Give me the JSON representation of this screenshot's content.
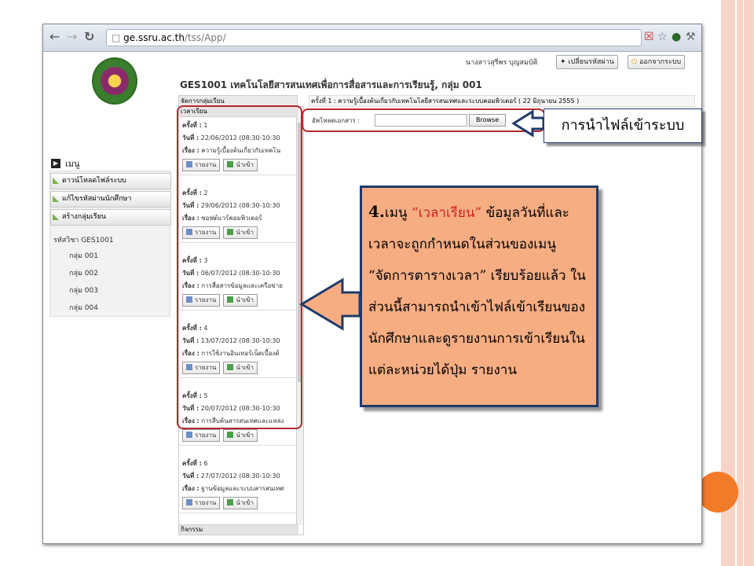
{
  "browser": {
    "url_host": "ge.ssru.ac.th",
    "url_path": "/tss/App/"
  },
  "header": {
    "user_name": "นางสาวสุรีพร บุญสมบัติ",
    "change_password": "เปลี่ยนรหัสผ่าน",
    "logout": "ออกจากระบบ"
  },
  "course_title": "GES1001 เทคโนโลยีสารสนเทศเพื่อการสื่อสารและการเรียนรู้, กลุ่ม 001",
  "sidebar": {
    "menu_label": "เมนู",
    "items": [
      "ดาวน์โหลดไฟล์ระบบ",
      "แก้ไขรหัสผ่านนักศึกษา",
      "สร้างกลุ่มเรียน"
    ],
    "subject_label": "รหัสวิชา GES1001",
    "groups": [
      "กลุ่ม 001",
      "กลุ่ม 002",
      "กลุ่ม 003",
      "กลุ่ม 004"
    ]
  },
  "middle": {
    "manage_label": "จัดการกลุ่มเรียน",
    "schedule_label": "เวลาเรียน",
    "footer_label": "กิจกรรม",
    "labels": {
      "round": "ครั้งที่ :",
      "date": "วันที่ :",
      "topic": "เรื่อง :"
    },
    "report_button": "รายงาน",
    "import_button": "นำเข้า",
    "sessions": [
      {
        "no": "1",
        "date": "22/06/2012 (08:30-10:30",
        "topic": "ความรู้เบื้องต้นเกี่ยวกับเทคโน"
      },
      {
        "no": "2",
        "date": "29/06/2012 (08:30-10:30",
        "topic": "ซอฟต์แวร์คอมพิวเตอร์"
      },
      {
        "no": "3",
        "date": "06/07/2012 (08:30-10:30",
        "topic": "การสื่อสารข้อมูลและเครือข่าย"
      },
      {
        "no": "4",
        "date": "13/07/2012 (08:30-10:30",
        "topic": "การใช้งานอินเทอร์เน็ตเบื้องต้"
      },
      {
        "no": "5",
        "date": "20/07/2012 (08:30-10:30",
        "topic": "การสืบค้นสารสนเทศและแหล่ง"
      },
      {
        "no": "6",
        "date": "27/07/2012 (08:30-10:30",
        "topic": "ฐานข้อมูลและระบบสารสนเทศ"
      }
    ]
  },
  "right": {
    "session_header": "ครั้งที่ 1 : ความรู้เบื้องต้นเกี่ยวกับเทคโนโลยีสารสนเทศและระบบคอมพิวเตอร์ ( 22 มิถุนายน 2555 )",
    "upload_label": "อัพโหลดเอกสาร :",
    "browse_button": "Browse"
  },
  "annotations": {
    "top_callout": "การนำไฟล์เข้าระบบ",
    "main_number": "4.",
    "main_prefix": "เมนู ",
    "main_highlight": "“เวลาเรียน”",
    "main_text": " ข้อมูลวันที่และเวลาจะถูกกำหนดในส่วนของเมนู “จัดการตารางเวลา” เรียบร้อยแล้ว ในส่วนนี้สามารถนำเข้าไฟล์เข้าเรียนของนักศึกษาและดูรายงานการเข้าเรียนในแต่ละหน่วยได้ปุ่ม รายงาน"
  },
  "colors": {
    "callout_fill": "#f7ad82",
    "callout_border": "#1f3b6a",
    "highlight_red": "#cc2222",
    "frame_red": "#b8282f",
    "accent_circle": "#f27b2a"
  }
}
